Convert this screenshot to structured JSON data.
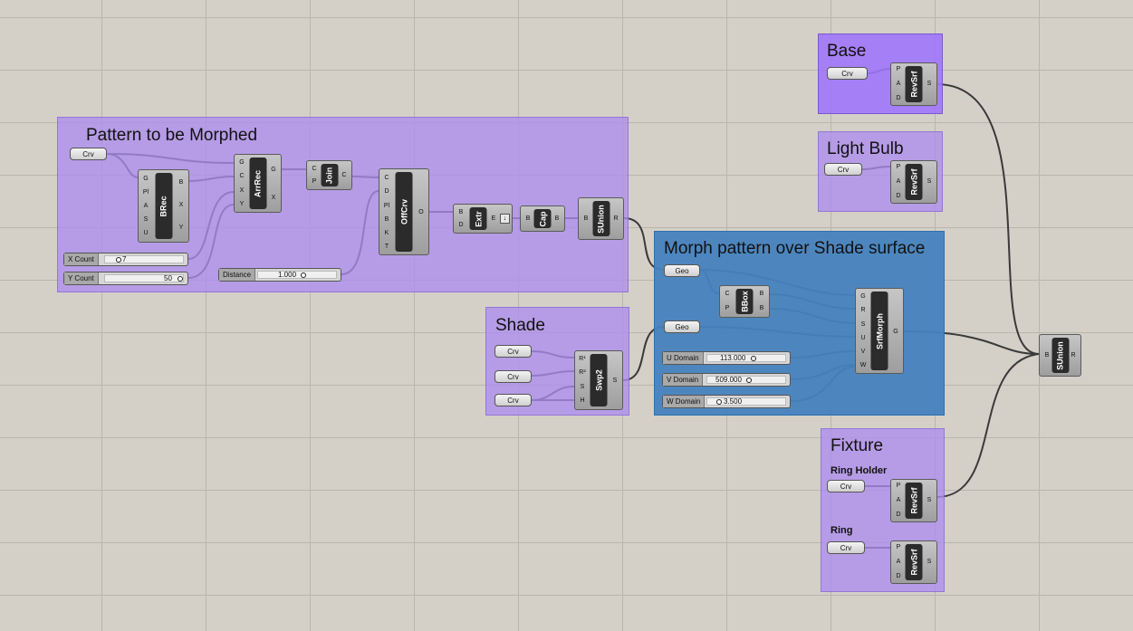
{
  "groups": {
    "pattern": "Pattern to be Morphed",
    "shade": "Shade",
    "morph": "Morph pattern over Shade surface",
    "base": "Base",
    "light_bulb": "Light Bulb",
    "fixture": "Fixture",
    "ring_holder": "Ring Holder",
    "ring": "Ring"
  },
  "params": {
    "crv": "Crv",
    "geo": "Geo"
  },
  "components": {
    "brec": {
      "name": "BRec",
      "inputs": [
        "G",
        "Pl",
        "A",
        "S",
        "U"
      ],
      "outputs": [
        "B",
        "X",
        "Y"
      ]
    },
    "arrrec": {
      "name": "ArrRec",
      "inputs": [
        "G",
        "C",
        "X",
        "Y"
      ],
      "outputs": [
        "G",
        "X"
      ]
    },
    "join": {
      "name": "Join",
      "inputs": [
        "C",
        "P"
      ],
      "outputs": [
        "C"
      ]
    },
    "offcrv": {
      "name": "OffCrv",
      "inputs": [
        "C",
        "D",
        "Pl",
        "B",
        "K",
        "T"
      ],
      "outputs": [
        "O"
      ]
    },
    "extr": {
      "name": "Extr",
      "inputs": [
        "B",
        "D"
      ],
      "outputs": [
        "E"
      ]
    },
    "cap": {
      "name": "Cap",
      "inputs": [
        "B"
      ],
      "outputs": [
        "B"
      ]
    },
    "sunion1": {
      "name": "SUnion",
      "inputs": [
        "B"
      ],
      "outputs": [
        "R"
      ]
    },
    "bbox": {
      "name": "BBox",
      "inputs": [
        "C",
        "P"
      ],
      "outputs": [
        "B",
        "B"
      ]
    },
    "srfmorph": {
      "name": "SrfMorph",
      "inputs": [
        "G",
        "R",
        "S",
        "U",
        "V",
        "W"
      ],
      "outputs": [
        "G"
      ]
    },
    "swp2": {
      "name": "Swp2",
      "inputs": [
        "R¹",
        "R²",
        "S",
        "H"
      ],
      "outputs": [
        "S"
      ]
    },
    "revsrf": {
      "name": "RevSrf",
      "inputs": [
        "P",
        "A",
        "D"
      ],
      "outputs": [
        "S"
      ]
    },
    "sunion2": {
      "name": "SUnion",
      "inputs": [
        "B"
      ],
      "outputs": [
        "R"
      ]
    }
  },
  "sliders": {
    "x_count": {
      "label": "X Count",
      "value": "7"
    },
    "y_count": {
      "label": "Y Count",
      "value": "50"
    },
    "distance": {
      "label": "Distance",
      "value": "1.000"
    },
    "u_domain": {
      "label": "U Domain",
      "value": "113.000"
    },
    "v_domain": {
      "label": "V Domain",
      "value": "509.000"
    },
    "w_domain": {
      "label": "W Domain",
      "value": "3.500"
    }
  },
  "colors": {
    "canvas": "#d4d0c8",
    "group_purple": "#ad8dee",
    "group_base": "#a076fa",
    "group_blue": "#4682be"
  }
}
